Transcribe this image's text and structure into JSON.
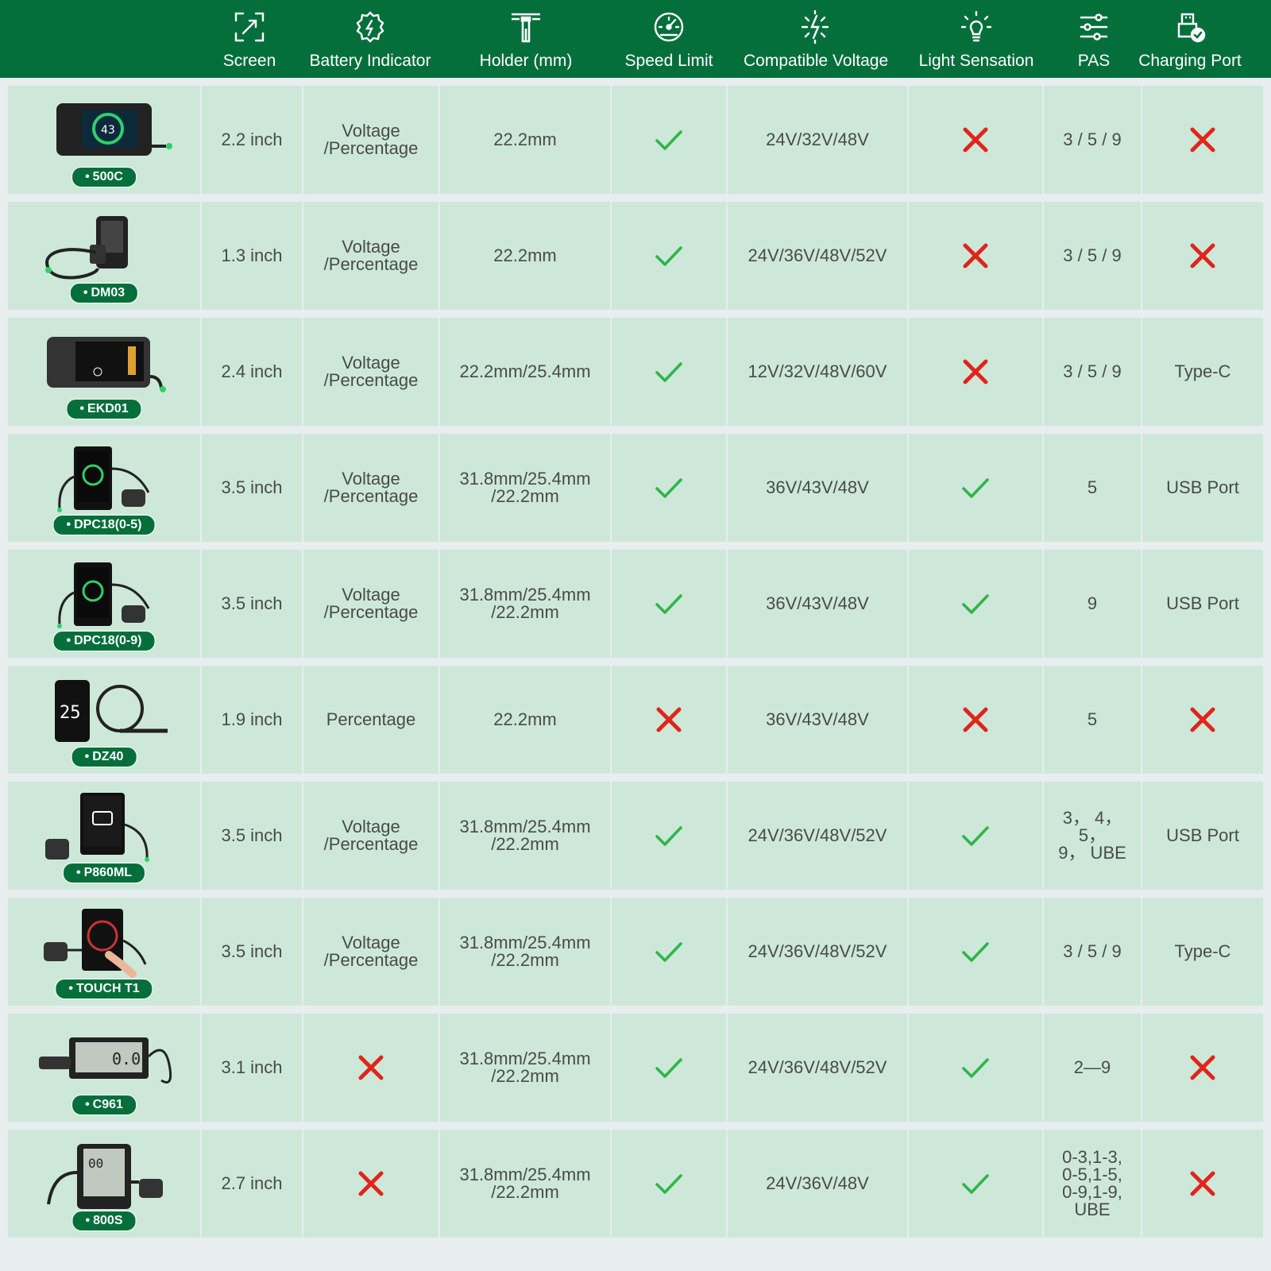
{
  "columns": [
    {
      "key": "screen",
      "label": "Screen",
      "icon": "resize-arrows-icon"
    },
    {
      "key": "battery",
      "label": "Battery Indicator",
      "icon": "battery-gear-icon"
    },
    {
      "key": "holder",
      "label": "Holder (mm)",
      "icon": "handlebar-clamp-icon"
    },
    {
      "key": "speed",
      "label": "Speed Limit",
      "icon": "speedometer-icon"
    },
    {
      "key": "voltage",
      "label": "Compatible Voltage",
      "icon": "voltage-spark-icon"
    },
    {
      "key": "light",
      "label": "Light Sensation",
      "icon": "lightbulb-icon"
    },
    {
      "key": "pas",
      "label": "PAS",
      "icon": "sliders-icon"
    },
    {
      "key": "charging",
      "label": "Charging Port",
      "icon": "usb-check-icon"
    }
  ],
  "rows": [
    {
      "model": "500C",
      "image": "display-500c",
      "screen": "2.2 inch",
      "battery": "Voltage\n/Percentage",
      "holder": "22.2mm",
      "speed": "yes",
      "voltage": "24V/32V/48V",
      "light": "no",
      "pas": "3 / 5 / 9",
      "charging": "no"
    },
    {
      "model": "DM03",
      "image": "display-dm03",
      "screen": "1.3 inch",
      "battery": "Voltage\n/Percentage",
      "holder": "22.2mm",
      "speed": "yes",
      "voltage": "24V/36V/48V/52V",
      "light": "no",
      "pas": "3 / 5 / 9",
      "charging": "no"
    },
    {
      "model": "EKD01",
      "image": "display-ekd01",
      "screen": "2.4 inch",
      "battery": "Voltage\n/Percentage",
      "holder": "22.2mm/25.4mm",
      "speed": "yes",
      "voltage": "12V/32V/48V/60V",
      "light": "no",
      "pas": "3 / 5 / 9",
      "charging": "Type-C"
    },
    {
      "model": "DPC18(0-5)",
      "image": "display-dpc18",
      "screen": "3.5 inch",
      "battery": "Voltage\n/Percentage",
      "holder": "31.8mm/25.4mm\n/22.2mm",
      "speed": "yes",
      "voltage": "36V/43V/48V",
      "light": "yes",
      "pas": "5",
      "charging": "USB Port"
    },
    {
      "model": "DPC18(0-9)",
      "image": "display-dpc18",
      "screen": "3.5 inch",
      "battery": "Voltage\n/Percentage",
      "holder": "31.8mm/25.4mm\n/22.2mm",
      "speed": "yes",
      "voltage": "36V/43V/48V",
      "light": "yes",
      "pas": "9",
      "charging": "USB Port"
    },
    {
      "model": "DZ40",
      "image": "display-dz40",
      "screen": "1.9 inch",
      "battery": "Percentage",
      "holder": "22.2mm",
      "speed": "no",
      "voltage": "36V/43V/48V",
      "light": "no",
      "pas": "5",
      "charging": "no"
    },
    {
      "model": "P860ML",
      "image": "display-p860ml",
      "screen": "3.5 inch",
      "battery": "Voltage\n/Percentage",
      "holder": "31.8mm/25.4mm\n/22.2mm",
      "speed": "yes",
      "voltage": "24V/36V/48V/52V",
      "light": "yes",
      "pas": "3， 4， 5，\n9， UBE",
      "charging": "USB Port"
    },
    {
      "model": "TOUCH T1",
      "image": "display-touch-t1",
      "screen": "3.5 inch",
      "battery": "Voltage\n/Percentage",
      "holder": "31.8mm/25.4mm\n/22.2mm",
      "speed": "yes",
      "voltage": "24V/36V/48V/52V",
      "light": "yes",
      "pas": "3 / 5 / 9",
      "charging": "Type-C"
    },
    {
      "model": "C961",
      "image": "display-c961",
      "screen": "3.1 inch",
      "battery": "no",
      "holder": "31.8mm/25.4mm\n/22.2mm",
      "speed": "yes",
      "voltage": "24V/36V/48V/52V",
      "light": "yes",
      "pas": "2—9",
      "charging": "no"
    },
    {
      "model": "800S",
      "image": "display-800s",
      "screen": "2.7 inch",
      "battery": "no",
      "holder": "31.8mm/25.4mm\n/22.2mm",
      "speed": "yes",
      "voltage": "24V/36V/48V",
      "light": "yes",
      "pas": "0-3,1-3,\n0-5,1-5,\n0-9,1-9,\nUBE",
      "charging": "no"
    }
  ],
  "colors": {
    "header": "#046f3b",
    "cell": "#cde8d9",
    "check": "#2fb54a",
    "cross": "#e0251b",
    "text": "#4a4a4a",
    "gap": "#e8edf0"
  }
}
